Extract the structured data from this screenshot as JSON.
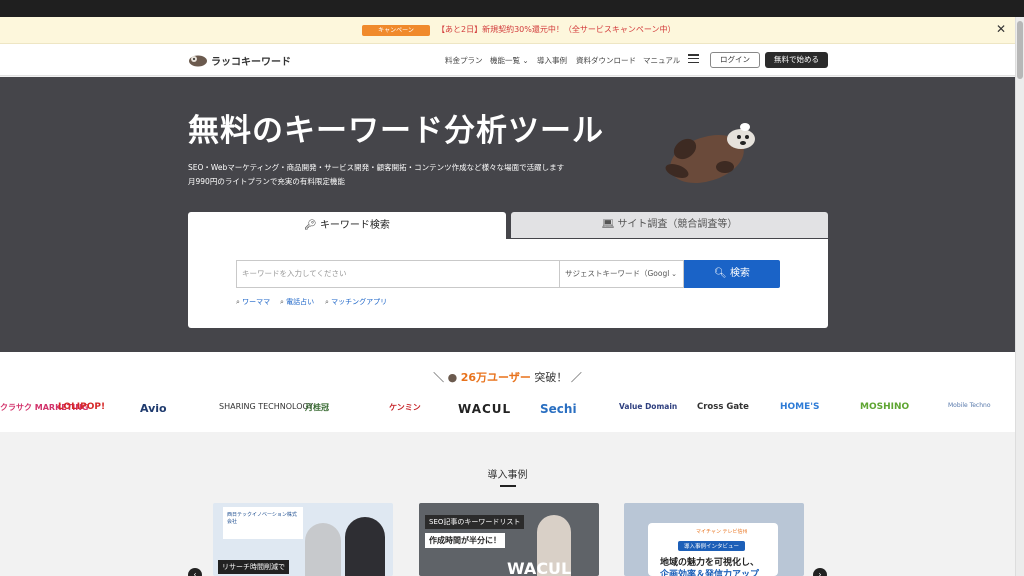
{
  "campaign": {
    "badge": "キャンペーン",
    "text": "【あと2日】新規契約30%還元中！（全サービスキャンペーン中）"
  },
  "header": {
    "logo": "ラッコキーワード",
    "nav": [
      "料金プラン",
      "機能一覧 ⌄",
      "導入事例",
      "資料ダウンロード",
      "マニュアル"
    ],
    "login": "ログイン",
    "start": "無料で始める"
  },
  "hero": {
    "title": "無料のキーワード分析ツール",
    "sub1": "SEO・Webマーケティング・商品開発・サービス開発・顧客開拓・コンテンツ作成など様々な場面で活躍します",
    "sub2": "月990円のライトプランで充実の有料限定機能"
  },
  "search": {
    "tab_keyword": "キーワード検索",
    "tab_site": "サイト調査（競合調査等）",
    "placeholder": "キーワードを入力してください",
    "select_value": "サジェストキーワード（Googl",
    "button": "検索",
    "suggestions": [
      "ワーママ",
      "電話占い",
      "マッチングアプリ"
    ]
  },
  "users": {
    "prefix": "＼",
    "count": "26万ユーザー",
    "suffix": "突破！",
    "slash": "／",
    "logos": [
      "クラサク MARKETING",
      "LOLIPOP!",
      "Avio",
      "SHARING TECHNOLOGY",
      "月桂冠",
      "ケンミン",
      "WACUL",
      "Sechi",
      "Value Domain",
      "Cross Gate",
      "HOME'S",
      "MOSHINO",
      "Mobile Techno"
    ]
  },
  "cases": {
    "title": "導入事例",
    "card1_caption": "リサーチ時間削減で",
    "card1_company": "西日テックイノベーション株式会社",
    "card2_label": "SEO記事のキーワードリスト",
    "card2_text": "作成時間が半分に！",
    "card2_brand": "WACUL",
    "card3_company": "マイチャン テレビ信州",
    "card3_badge": "導入事例インタビュー",
    "card3_text1": "地域の魅力を可視化し、",
    "card3_text2": "企画効率＆発信力アップ"
  }
}
